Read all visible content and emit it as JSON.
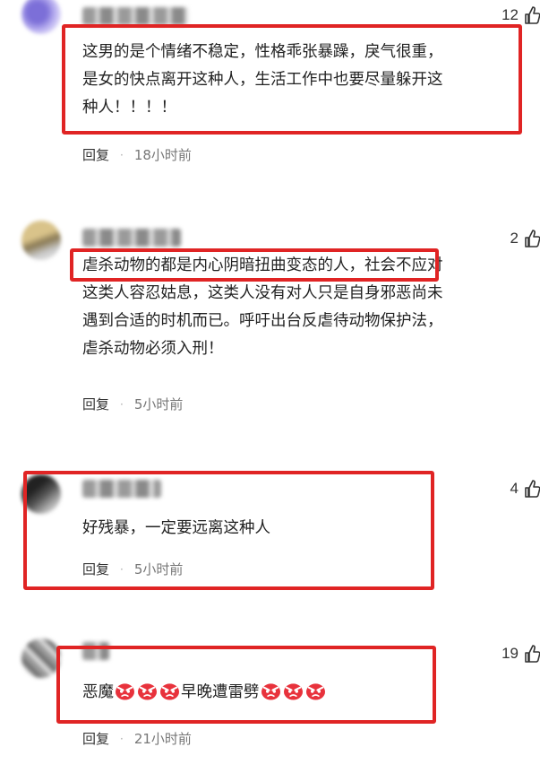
{
  "colors": {
    "highlight_box": "#e02424",
    "text": "#222222",
    "meta": "#777777",
    "emoji_face": "#e8323c"
  },
  "comments": [
    {
      "likes": "12",
      "text": "这男的是个情绪不稳定，性格乖张暴躁，戾气很重，\n是女的快点离开这种人，生活工作中也要尽量躲开这\n种人！！！！",
      "reply_label": "回复",
      "separator": "·",
      "time": "18小时前"
    },
    {
      "likes": "2",
      "text": "虐杀动物的都是内心阴暗扭曲变态的人，社会不应对\n这类人容忍姑息，这类人没有对人只是自身邪恶尚未\n遇到合适的时机而已。呼吁出台反虐待动物保护法，\n虐杀动物必须入刑！",
      "reply_label": "回复",
      "separator": "·",
      "time": "5小时前"
    },
    {
      "likes": "4",
      "text": "好残暴，一定要远离这种人",
      "reply_label": "回复",
      "separator": "·",
      "time": "5小时前"
    },
    {
      "likes": "19",
      "text_part1": "恶魔",
      "text_part2": "早晚遭雷劈",
      "emoji_name": "angry-face-emoji",
      "reply_label": "回复",
      "separator": "·",
      "time": "21小时前"
    }
  ]
}
